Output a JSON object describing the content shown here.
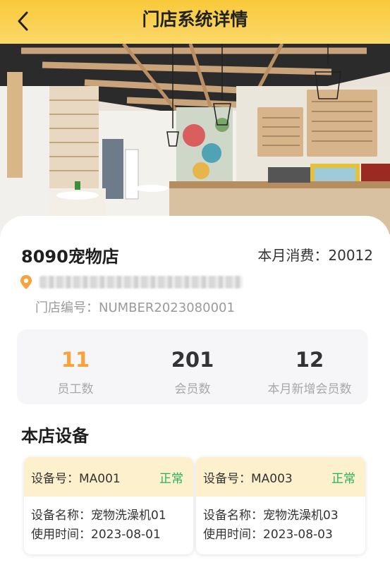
{
  "nav": {
    "title": "门店系统详情",
    "back_icon": "chevron-left-icon"
  },
  "store": {
    "name": "8090宠物店",
    "monthly_consume_label": "本月消费：",
    "monthly_consume_value": "20012",
    "address": "■■■■■■■■■■■■■■■■■■■■",
    "number_label": "门店编号：",
    "number_value": "NUMBER2023080001",
    "location_icon": "location-pin-icon",
    "accent_color": "#f7a23a"
  },
  "stats": [
    {
      "value": "11",
      "label": "员工数"
    },
    {
      "value": "201",
      "label": "会员数"
    },
    {
      "value": "12",
      "label": "本月新增会员数"
    }
  ],
  "devices_section": {
    "title": "本店设备",
    "devices": [
      {
        "id_label": "设备号：",
        "id": "MA001",
        "status": "正常",
        "name_label": "设备名称：",
        "name": "宠物洗澡机01",
        "time_label": "使用时间：",
        "time": "2023-08-01"
      },
      {
        "id_label": "设备号：",
        "id": "MA003",
        "status": "正常",
        "name_label": "设备名称：",
        "name": "宠物洗澡机03",
        "time_label": "使用时间：",
        "time": "2023-08-03"
      }
    ]
  },
  "colors": {
    "header": "#f9c93a",
    "status_ok": "#27b15f",
    "device_header": "#fdf0cc"
  }
}
